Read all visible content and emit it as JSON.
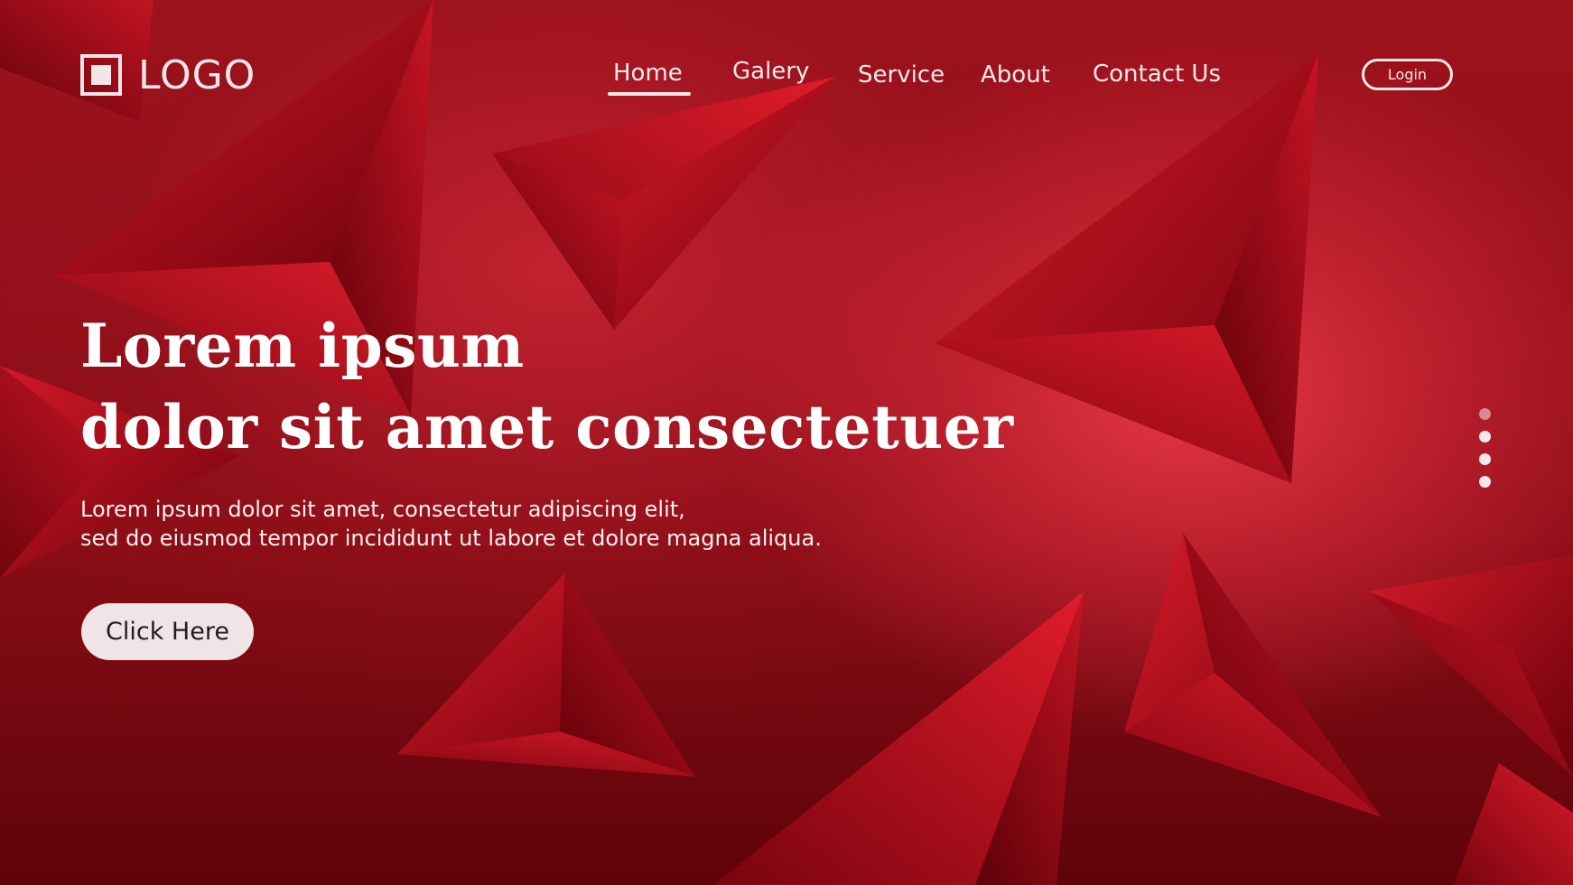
{
  "logo": {
    "text": "LOGO",
    "icon": "square-logo-icon"
  },
  "nav": {
    "items": [
      {
        "label": "Home",
        "active": true
      },
      {
        "label": "Galery",
        "active": false
      },
      {
        "label": "Service",
        "active": false
      },
      {
        "label": "About",
        "active": false
      },
      {
        "label": "Contact Us",
        "active": false
      }
    ],
    "login_label": "Login"
  },
  "hero": {
    "headline_line1": "Lorem ipsum",
    "headline_line2": "dolor sit amet consectetuer",
    "body_line1": "Lorem ipsum dolor sit amet, consectetur adipiscing elit,",
    "body_line2": "sed do eiusmod tempor incididunt ut labore et dolore magna aliqua.",
    "cta_label": "Click Here"
  },
  "pagination": {
    "count": 4,
    "active_index": 0
  },
  "colors": {
    "accent": "#c8202f",
    "background_dark": "#7d0a12",
    "text_light": "#f6e8ea",
    "button_bg": "#f1e4e6"
  }
}
